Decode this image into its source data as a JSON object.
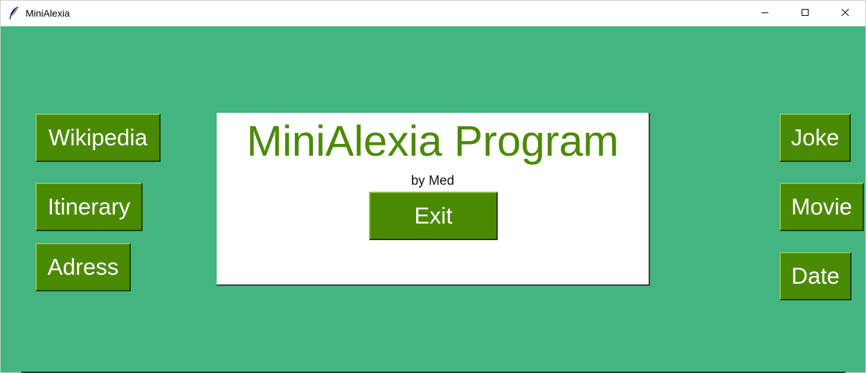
{
  "window": {
    "title": "MiniAlexia",
    "icon": "feather-icon",
    "controls": [
      "minimize-icon",
      "maximize-icon",
      "close-icon"
    ]
  },
  "colors": {
    "background": "#42b580",
    "button": "#4a8a00",
    "title_text": "#4a8a00",
    "panel": "#ffffff"
  },
  "left_buttons": {
    "wikipedia": "Wikipedia",
    "itinerary": "Itinerary",
    "adress": "Adress"
  },
  "right_buttons": {
    "joke": "Joke",
    "movie": "Movie",
    "date": "Date"
  },
  "panel": {
    "title": "MiniAlexia Program",
    "subtitle": "by Med",
    "exit_label": "Exit"
  }
}
